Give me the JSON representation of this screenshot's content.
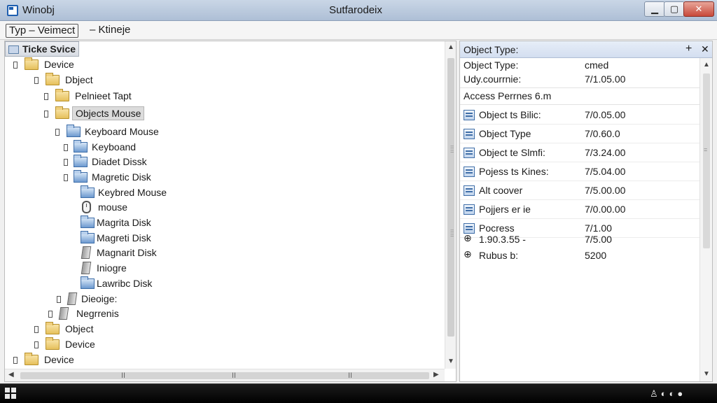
{
  "window": {
    "app_title": "Winobj",
    "center_title": "Sutfarodeix",
    "min_label": "▁",
    "max_label": "▢",
    "close_label": "✕"
  },
  "toolbar": {
    "item1": "Typ  – Veimect",
    "item2": "– Ktineje"
  },
  "tree": {
    "header": "Ticke Svice",
    "nodes": [
      {
        "label": "Device",
        "icon": "folder-icon"
      },
      {
        "label": "Dbject",
        "icon": "folder-icon"
      },
      {
        "label": "Pelnieet Tapt",
        "icon": "folder-icon"
      },
      {
        "label": "Objects Mouse",
        "icon": "folder-icon"
      },
      {
        "label": "Keyboard Mouse",
        "icon": "blue-folder-icon"
      },
      {
        "label": "Keyboand",
        "icon": "blue-folder-icon"
      },
      {
        "label": "Diadet Dissk",
        "icon": "blue-folder-icon"
      },
      {
        "label": "Magretic Disk",
        "icon": "blue-folder-icon"
      },
      {
        "label": "Keybred Mouse",
        "icon": "blue-folder-icon"
      },
      {
        "label": "mouse",
        "icon": "mouse-icon"
      },
      {
        "label": "Magrita Disk",
        "icon": "blue-folder-icon"
      },
      {
        "label": "Magreti Disk",
        "icon": "blue-folder-icon"
      },
      {
        "label": "Magnarit Disk",
        "icon": "disk-icon"
      },
      {
        "label": "Iniogre",
        "icon": "disk-icon"
      },
      {
        "label": "Lawribc Disk",
        "icon": "blue-folder-icon"
      },
      {
        "label": "Dieoige:",
        "icon": "disk-icon"
      },
      {
        "label": "Negrrenis",
        "icon": "disk-icon"
      },
      {
        "label": "Object",
        "icon": "folder-icon"
      },
      {
        "label": "Device",
        "icon": "folder-icon"
      },
      {
        "label": "Device",
        "icon": "folder-icon"
      }
    ]
  },
  "properties": {
    "title": "Object Type:",
    "plus": "+",
    "close": "✕",
    "summary": [
      {
        "key": "Object Type:",
        "value": "cmed"
      },
      {
        "key": "Udy.courrnie:",
        "value": "7/1.05.00"
      }
    ],
    "access_label": "Access Perrnes 6.m",
    "rows": [
      {
        "key": "Object ts Bilic:",
        "value": "7/0.05.00",
        "icon": "doc-icon"
      },
      {
        "key": "Object Type",
        "value": "7/0.60.0",
        "icon": "doc-icon"
      },
      {
        "key": "Object te Slmfi:",
        "value": "7/3.24.00",
        "icon": "doc-icon"
      },
      {
        "key": "Pojess ts Kines:",
        "value": "7/5.04.00",
        "icon": "doc-icon"
      },
      {
        "key": "Alt coover",
        "value": "7/5.00.00",
        "icon": "doc-icon"
      },
      {
        "key": "Pojjers er ie",
        "value": "7/0.00.00",
        "icon": "doc-icon"
      },
      {
        "key": "Pocress",
        "value": "7/1.00",
        "icon": "doc-icon"
      },
      {
        "key": "1.90.3.55  -",
        "value": "7/5.00",
        "icon": "plus-icon"
      },
      {
        "key": "Rubus b:",
        "value": "5200",
        "icon": "plus-icon"
      }
    ]
  },
  "scroll": {
    "up": "▲",
    "down": "▼",
    "left": "◀",
    "right": "▶",
    "grip": "II"
  },
  "taskbar": {
    "tray": "♙◐◐●"
  }
}
